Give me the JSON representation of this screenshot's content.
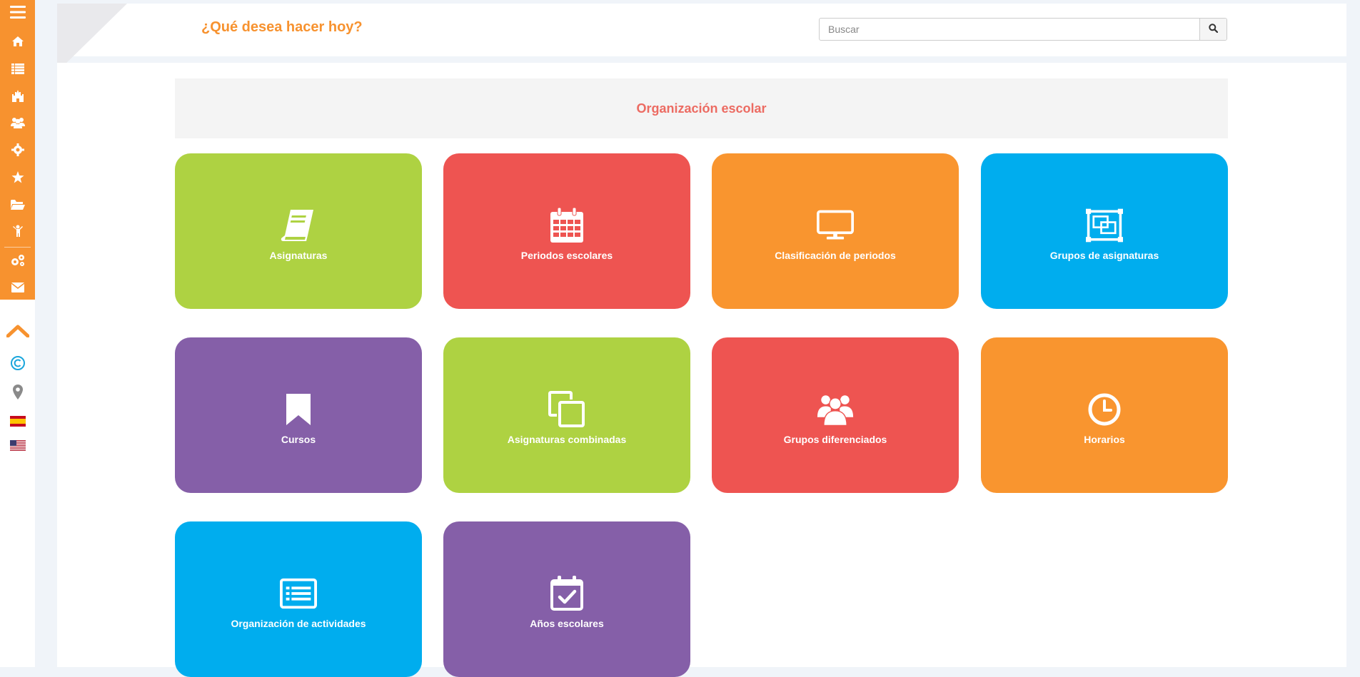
{
  "header": {
    "title": "¿Qué desea hacer hoy?",
    "search_placeholder": "Buscar"
  },
  "sidebar": {
    "items": [
      {
        "icon": "menu-icon"
      },
      {
        "icon": "home-icon"
      },
      {
        "icon": "list-icon"
      },
      {
        "icon": "castle-icon"
      },
      {
        "icon": "users-icon"
      },
      {
        "icon": "gear-icon"
      },
      {
        "icon": "star-icon"
      },
      {
        "icon": "folder-open-icon"
      },
      {
        "icon": "child-icon"
      },
      {
        "icon": "cogs-icon"
      },
      {
        "icon": "envelope-icon"
      }
    ],
    "bottom": [
      {
        "icon": "chevron-up-icon"
      },
      {
        "icon": "copyright-icon"
      },
      {
        "icon": "map-marker-icon"
      },
      {
        "icon": "flag-spain-icon"
      },
      {
        "icon": "flag-usa-icon"
      }
    ]
  },
  "section": {
    "title": "Organización escolar"
  },
  "tiles": [
    {
      "label": "Asignaturas",
      "icon": "book-icon",
      "color": "#aed242"
    },
    {
      "label": "Periodos escolares",
      "icon": "calendar-icon",
      "color": "#ee5451"
    },
    {
      "label": "Clasificación de periodos",
      "icon": "desktop-icon",
      "color": "#f9952f"
    },
    {
      "label": "Grupos de asignaturas",
      "icon": "object-group-icon",
      "color": "#00adee"
    },
    {
      "label": "Cursos",
      "icon": "bookmark-icon",
      "color": "#855fa8"
    },
    {
      "label": "Asignaturas combinadas",
      "icon": "copy-icon",
      "color": "#aed242"
    },
    {
      "label": "Grupos diferenciados",
      "icon": "users-icon",
      "color": "#ee5451"
    },
    {
      "label": "Horarios",
      "icon": "clock-icon",
      "color": "#f9952f"
    },
    {
      "label": "Organización de actividades",
      "icon": "list-alt-icon",
      "color": "#00adee"
    },
    {
      "label": "Años escolares",
      "icon": "calendar-check-icon",
      "color": "#855fa8"
    }
  ],
  "colors": {
    "accent": "#f7922f",
    "section_title": "#ec6b62"
  }
}
